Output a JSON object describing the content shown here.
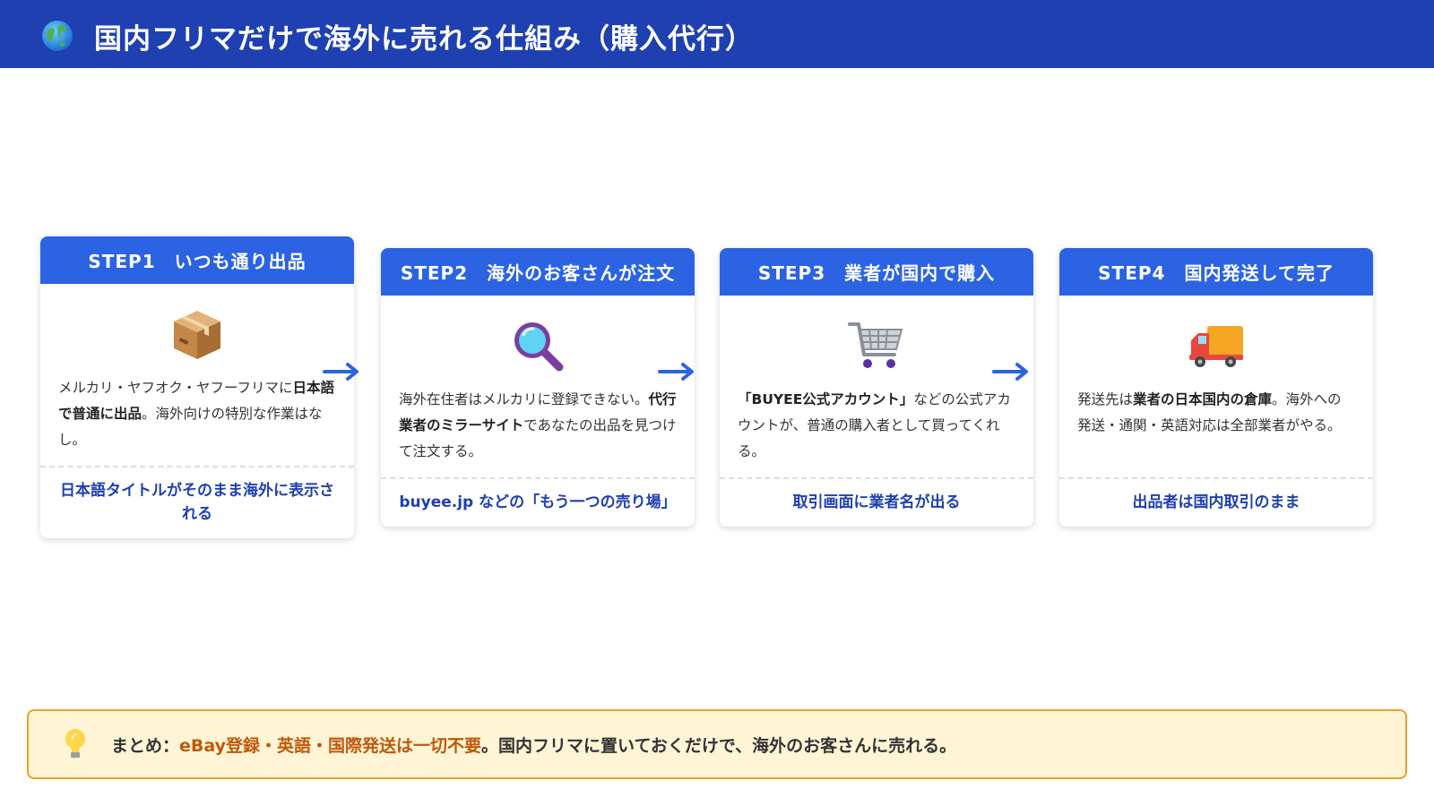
{
  "header": {
    "title": "国内フリマだけで海外に売れる仕組み（購入代行）",
    "icon": "globe-icon"
  },
  "steps": [
    {
      "title": "STEP1　いつも通り出品",
      "icon": "package-icon",
      "body": {
        "p1": "メルカリ・ヤフオク・ヤフーフリマに",
        "b1": "日本語で普通に出品",
        "p2": "。海外向けの特別な作業はなし。"
      },
      "footer": "日本語タイトルがそのまま海外に表示される"
    },
    {
      "title": "STEP2　海外のお客さんが注文",
      "icon": "magnifier-icon",
      "body": {
        "p1": "海外在住者はメルカリに登録できない。",
        "b1": "代行業者のミラーサイト",
        "p2": "であなたの出品を見つけて注文する。"
      },
      "footer": "buyee.jp などの「もう一つの売り場」"
    },
    {
      "title": "STEP3　業者が国内で購入",
      "icon": "shopping-cart-icon",
      "body": {
        "p1": "",
        "b1": "「BUYEE公式アカウント」",
        "p2": "などの公式アカウントが、普通の購入者として買ってくれる。"
      },
      "footer": "取引画面に業者名が出る"
    },
    {
      "title": "STEP4　国内発送して完了",
      "icon": "delivery-truck-icon",
      "body": {
        "p1": "発送先は",
        "b1": "業者の日本国内の倉庫",
        "p2": "。海外への発送・通関・英語対応は全部業者がやる。"
      },
      "footer": "出品者は国内取引のまま"
    }
  ],
  "summary": {
    "icon": "lightbulb-icon",
    "prefix": "まとめ：",
    "highlight": "eBay登録・英語・国際発送は一切不要",
    "suffix": "。国内フリマに置いておくだけで、海外のお客さんに売れる。"
  },
  "colors": {
    "header_bg": "#1f40b0",
    "step_head": "#2b63e3",
    "footer_text": "#1f40b0",
    "summary_bg": "#fff5d6",
    "summary_border": "#f0a020",
    "summary_highlight": "#c0590a"
  }
}
